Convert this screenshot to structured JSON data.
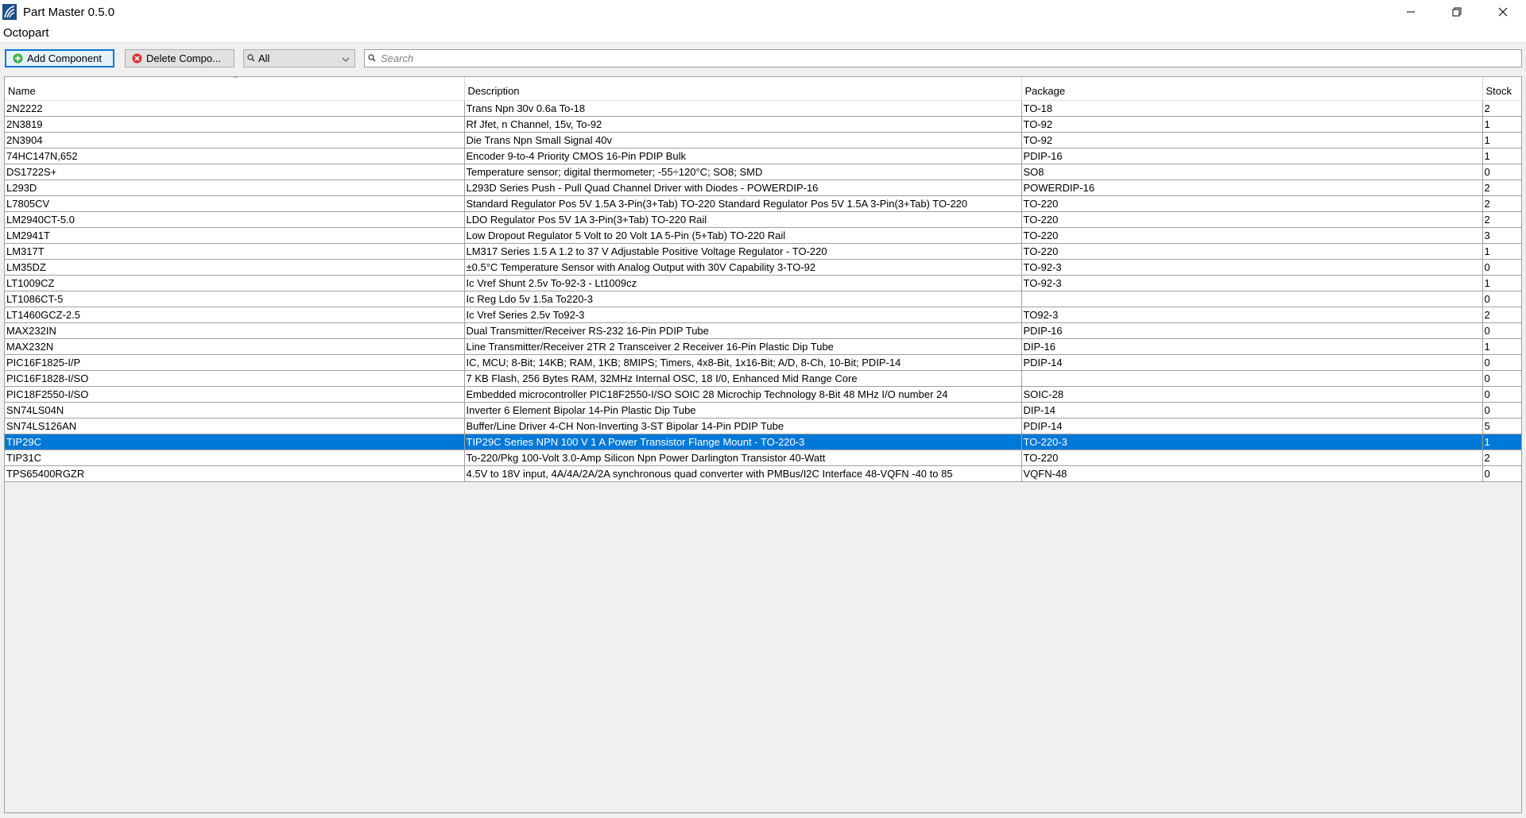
{
  "window": {
    "title": "Part Master 0.5.0",
    "controls": [
      "minimize-icon",
      "restore-icon",
      "close-icon"
    ]
  },
  "menu": [
    "Octopart"
  ],
  "toolbar": {
    "add_label": "Add Component",
    "delete_label": "Delete Compo...",
    "filter_value": "All",
    "search_placeholder": "Search"
  },
  "colors": {
    "selection": "#0078d7",
    "add_icon": "#3cae3c",
    "delete_icon": "#e03030"
  },
  "table": {
    "columns": [
      "Name",
      "Description",
      "Package",
      "Stock"
    ],
    "sort_column": "Name",
    "selected_row": 21,
    "rows": [
      [
        "2N2222",
        "Trans Npn 30v 0.6a To-18",
        "TO-18",
        "2"
      ],
      [
        "2N3819",
        "Rf Jfet, n Channel, 15v, To-92",
        "TO-92",
        "1"
      ],
      [
        "2N3904",
        "Die Trans Npn Small Signal 40v",
        "TO-92",
        "1"
      ],
      [
        "74HC147N,652",
        "Encoder 9-to-4 Priority CMOS 16-Pin PDIP Bulk",
        "PDIP-16",
        "1"
      ],
      [
        "DS1722S+",
        "Temperature sensor; digital thermometer; -55÷120°C; SO8; SMD",
        "SO8",
        "0"
      ],
      [
        "L293D",
        "L293D Series Push - Pull Quad Channel Driver with Diodes - POWERDIP-16",
        "POWERDIP-16",
        "2"
      ],
      [
        "L7805CV",
        "Standard Regulator Pos 5V 1.5A 3-Pin(3+Tab) TO-220 Standard Regulator Pos 5V 1.5A 3-Pin(3+Tab) TO-220",
        "TO-220",
        "2"
      ],
      [
        "LM2940CT-5.0",
        "LDO Regulator Pos 5V 1A 3-Pin(3+Tab) TO-220 Rail",
        "TO-220",
        "2"
      ],
      [
        "LM2941T",
        "Low Dropout Regulator 5 Volt to 20 Volt 1A 5-Pin (5+Tab) TO-220 Rail",
        "TO-220",
        "3"
      ],
      [
        "LM317T",
        "LM317 Series 1.5 A 1.2 to 37 V Adjustable Positive Voltage Regulator - TO-220",
        "TO-220",
        "1"
      ],
      [
        "LM35DZ",
        "±0.5°C Temperature Sensor with Analog Output with 30V Capability 3-TO-92",
        "TO-92-3",
        "0"
      ],
      [
        "LT1009CZ",
        "Ic Vref Shunt 2.5v To-92-3 - Lt1009cz",
        "TO-92-3",
        "1"
      ],
      [
        "LT1086CT-5",
        "Ic Reg Ldo 5v 1.5a To220-3",
        "",
        "0"
      ],
      [
        "LT1460GCZ-2.5",
        "Ic Vref Series 2.5v To92-3",
        "TO92-3",
        "2"
      ],
      [
        "MAX232IN",
        "Dual Transmitter/Receiver RS-232 16-Pin PDIP Tube",
        "PDIP-16",
        "0"
      ],
      [
        "MAX232N",
        "Line Transmitter/Receiver 2TR 2 Transceiver 2 Receiver 16-Pin Plastic Dip Tube",
        "DIP-16",
        "1"
      ],
      [
        "PIC16F1825-I/P",
        "IC, MCU; 8-Bit; 14KB; RAM, 1KB; 8MIPS; Timers, 4x8-Bit, 1x16-Bit; A/D, 8-Ch, 10-Bit; PDIP-14",
        "PDIP-14",
        "0"
      ],
      [
        "PIC16F1828-I/SO",
        "7 KB Flash, 256 Bytes RAM, 32MHz Internal OSC, 18 I/0, Enhanced Mid Range Core",
        "",
        "0"
      ],
      [
        "PIC18F2550-I/SO",
        "Embedded microcontroller PIC18F2550-I/SO SOIC 28 Microchip Technology 8-Bit 48 MHz I/O number 24",
        "SOIC-28",
        "0"
      ],
      [
        "SN74LS04N",
        "Inverter 6 Element Bipolar 14-Pin Plastic Dip Tube",
        "DIP-14",
        "0"
      ],
      [
        "SN74LS126AN",
        "Buffer/Line Driver 4-CH Non-Inverting 3-ST Bipolar 14-Pin PDIP Tube",
        "PDIP-14",
        "5"
      ],
      [
        "TIP29C",
        "TIP29C Series NPN 100 V 1 A Power Transistor Flange Mount - TO-220-3",
        "TO-220-3",
        "1"
      ],
      [
        "TIP31C",
        "To-220/Pkg 100-Volt 3.0-Amp Silicon Npn Power Darlington Transistor 40-Watt",
        "TO-220",
        "2"
      ],
      [
        "TPS65400RGZR",
        "4.5V to 18V input, 4A/4A/2A/2A synchronous quad converter with PMBus/I2C Interface 48-VQFN -40 to 85",
        "VQFN-48",
        "0"
      ]
    ]
  }
}
